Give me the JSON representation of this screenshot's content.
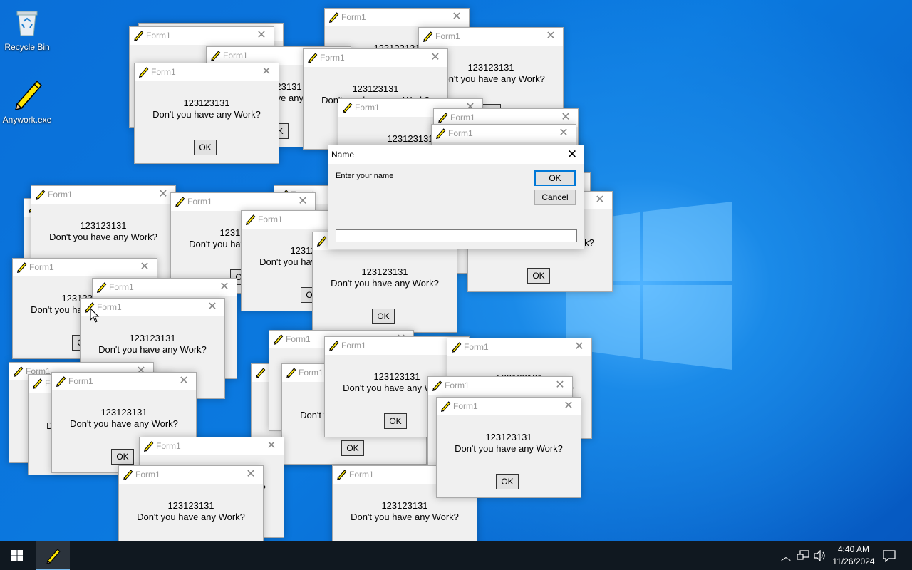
{
  "desktop": {
    "icons": [
      {
        "label": "Recycle Bin",
        "icon": "recycle-bin-icon"
      },
      {
        "label": "Anywork.exe",
        "icon": "pencil-folder-icon"
      }
    ]
  },
  "form_window": {
    "title": "Form1",
    "message_line1": "123123131",
    "message_line2": "Don't you have any Work?",
    "ok_label": "OK",
    "icon": "pencil-folder-icon"
  },
  "name_dialog": {
    "title": "Name",
    "prompt": "Enter your name",
    "ok_label": "OK",
    "cancel_label": "Cancel",
    "input_value": ""
  },
  "taskbar": {
    "time": "4:40 AM",
    "date": "11/26/2024"
  },
  "colors": {
    "desktop_bg": "#0b74dc",
    "taskbar_bg": "#101820",
    "dialog_bg": "#f0f0f0",
    "accent": "#0078d7"
  }
}
